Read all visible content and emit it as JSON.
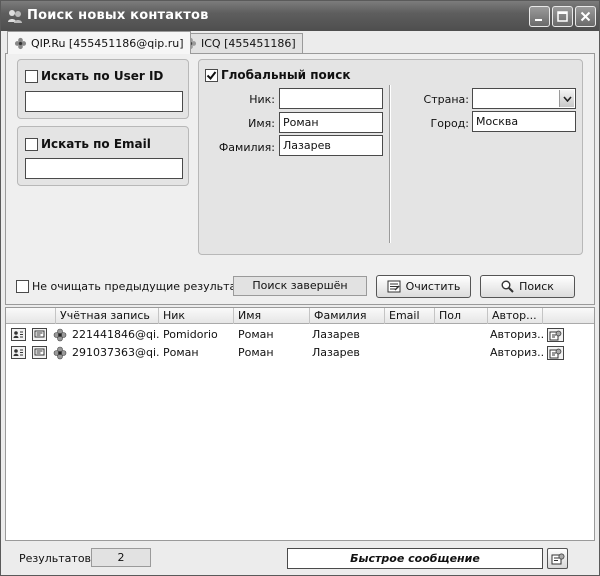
{
  "window": {
    "title": "Поиск новых контактов",
    "controls": [
      "minimize-icon",
      "maximize-icon",
      "close-icon"
    ]
  },
  "tabs": [
    {
      "label": "QIP.Ru [455451186@qip.ru]",
      "active": true,
      "icon": "qip-flower-icon"
    },
    {
      "label": "ICQ [455451186]",
      "active": false,
      "icon": "icq-flower-icon"
    }
  ],
  "search": {
    "by_userid": {
      "label": "Искать по User ID",
      "checked": false,
      "value": ""
    },
    "by_email": {
      "label": "Искать по Email",
      "checked": false,
      "value": ""
    },
    "global": {
      "label": "Глобальный поиск",
      "checked": true,
      "nick_label": "Ник:",
      "nick_value": "",
      "name_label": "Имя:",
      "name_value": "Роман",
      "surname_label": "Фамилия:",
      "surname_value": "Лазарев",
      "country_label": "Страна:",
      "country_value": "",
      "city_label": "Город:",
      "city_value": "Москва"
    }
  },
  "controls": {
    "keep_results_label": "Не очищать предыдущие результаты",
    "keep_results_checked": false,
    "status_text": "Поиск завершён",
    "clear_label": "Очистить",
    "search_label": "Поиск"
  },
  "results": {
    "columns": [
      "Учётная запись",
      "Ник",
      "Имя",
      "Фамилия",
      "Email",
      "Пол",
      "Автор..."
    ],
    "rows": [
      {
        "account": "221441846@qi...",
        "nick": "Pomidorio",
        "name": "Роман",
        "surname": "Лазарев",
        "email": "",
        "gender": "",
        "auth": "Авториз..."
      },
      {
        "account": "291037363@qi...",
        "nick": "Роман",
        "name": "Роман",
        "surname": "Лазарев",
        "email": "",
        "gender": "",
        "auth": "Авториз..."
      }
    ]
  },
  "footer": {
    "results_label": "Результатов:",
    "results_count": "2",
    "quick_message_label": "Быстрое сообщение"
  }
}
